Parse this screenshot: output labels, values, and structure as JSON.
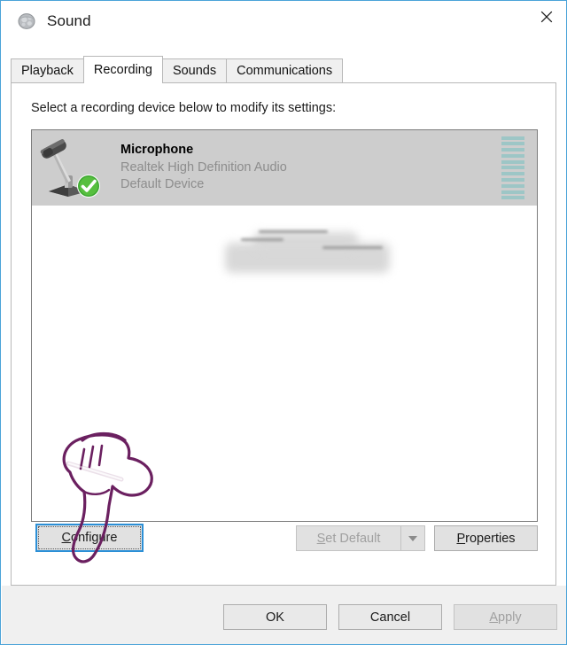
{
  "window": {
    "title": "Sound",
    "icon": "sound-speaker-icon",
    "close_label": "×",
    "border_color": "#4aa3d8"
  },
  "tabs": [
    {
      "label": "Playback",
      "active": false
    },
    {
      "label": "Recording",
      "active": true
    },
    {
      "label": "Sounds",
      "active": false
    },
    {
      "label": "Communications",
      "active": false
    }
  ],
  "page": {
    "instruction": "Select a recording device below to modify its settings:"
  },
  "devices": [
    {
      "name": "Microphone",
      "driver": "Realtek High Definition Audio",
      "status": "Default Device",
      "selected": true,
      "icon": "microphone-icon",
      "badge": "default-device-check-icon",
      "meter_level": 11,
      "meter_segments": 11,
      "meter_color": "#9dc6c6"
    }
  ],
  "device_actions": {
    "configure_label": "Configure",
    "configure_accel": "C",
    "configure_focused": true,
    "set_default_label": "Set Default",
    "set_default_accel": "S",
    "set_default_enabled": false,
    "set_default_dropdown_icon": "chevron-down-icon",
    "properties_label": "Properties",
    "properties_accel": "P",
    "properties_enabled": true
  },
  "footer": {
    "ok_label": "OK",
    "cancel_label": "Cancel",
    "apply_label": "Apply",
    "apply_accel": "A",
    "apply_enabled": false
  },
  "annotation": {
    "type": "hand-pointer-drawing",
    "color": "#6b2060",
    "points_at": "Configure"
  }
}
